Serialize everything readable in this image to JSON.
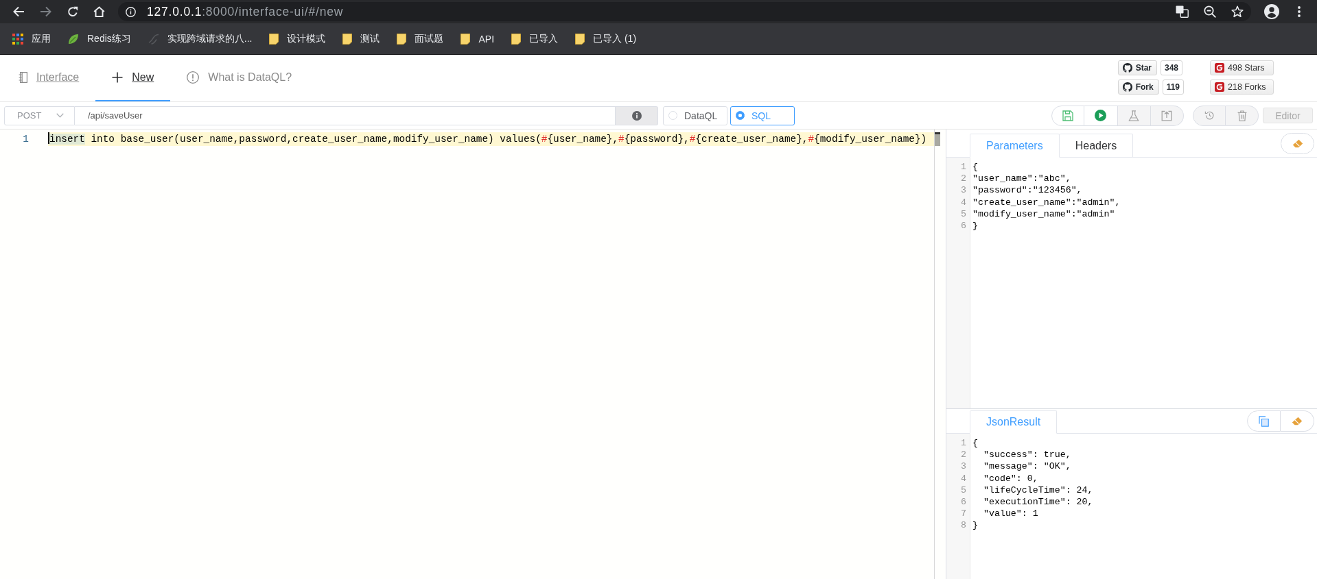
{
  "browser": {
    "url_host": "127.0.0.1",
    "url_rest": ":8000/interface-ui/#/new",
    "bookmarks": [
      {
        "label": "应用",
        "kind": "apps"
      },
      {
        "label": "Redis练习",
        "kind": "leaf"
      },
      {
        "label": "实现跨域请求的八...",
        "kind": "page"
      },
      {
        "label": "设计模式",
        "kind": "folder"
      },
      {
        "label": "测试",
        "kind": "folder"
      },
      {
        "label": "面试题",
        "kind": "folder"
      },
      {
        "label": "API",
        "kind": "folder"
      },
      {
        "label": "已导入",
        "kind": "folder"
      },
      {
        "label": "已导入 (1)",
        "kind": "folder"
      }
    ]
  },
  "nav_tabs": [
    {
      "label": "Interface",
      "kind": "book",
      "selected": false,
      "underlined": true
    },
    {
      "label": "New",
      "kind": "plus",
      "selected": true,
      "underlined": true
    },
    {
      "label": "What is DataQL?",
      "kind": "info",
      "selected": false,
      "underlined": false
    }
  ],
  "github_badges": [
    {
      "label": "Star",
      "count": "348"
    },
    {
      "label": "Fork",
      "count": "119"
    }
  ],
  "gitee_badges": [
    {
      "label": "498 Stars"
    },
    {
      "label": "218 Forks"
    }
  ],
  "request": {
    "method": "POST",
    "path": "/api/saveUser",
    "modes": [
      {
        "label": "DataQL",
        "selected": false
      },
      {
        "label": "SQL",
        "selected": true
      }
    ]
  },
  "actions": [
    {
      "kind": "save",
      "disabled": false
    },
    {
      "kind": "run",
      "disabled": false
    },
    {
      "kind": "test",
      "disabled": true
    },
    {
      "kind": "publish",
      "disabled": true
    }
  ],
  "history_actions": [
    {
      "kind": "history",
      "disabled": true
    },
    {
      "kind": "delete",
      "disabled": true
    }
  ],
  "editor_toggle": {
    "label": "Editor",
    "disabled": true
  },
  "editor": {
    "lines": [
      {
        "number": "1",
        "active": true,
        "cursor": true,
        "tokens": [
          {
            "kind": "match",
            "text": "insert"
          },
          {
            "kind": "text",
            "text": " into base_user(user_name,password,create_user_name,modify_user_name) values("
          },
          {
            "kind": "hash",
            "text": "#"
          },
          {
            "kind": "text",
            "text": "{user_name},"
          },
          {
            "kind": "hash",
            "text": "#"
          },
          {
            "kind": "text",
            "text": "{password},"
          },
          {
            "kind": "hash",
            "text": "#"
          },
          {
            "kind": "text",
            "text": "{create_user_name},"
          },
          {
            "kind": "hash",
            "text": "#"
          },
          {
            "kind": "text",
            "text": "{modify_user_name})"
          }
        ]
      }
    ]
  },
  "parameters_panel": {
    "tabs": [
      {
        "label": "Parameters",
        "selected": true
      },
      {
        "label": "Headers",
        "selected": false
      }
    ],
    "lines": [
      {
        "number": "1",
        "code": "{"
      },
      {
        "number": "2",
        "code": "\"user_name\":\"abc\","
      },
      {
        "number": "3",
        "code": "\"password\":\"123456\","
      },
      {
        "number": "4",
        "code": "\"create_user_name\":\"admin\","
      },
      {
        "number": "5",
        "code": "\"modify_user_name\":\"admin\""
      },
      {
        "number": "6",
        "code": "}"
      }
    ]
  },
  "result_panel": {
    "tabs": [
      {
        "label": "JsonResult",
        "selected": true
      }
    ],
    "lines": [
      {
        "number": "1",
        "code": "{"
      },
      {
        "number": "2",
        "code": "  \"success\": true,"
      },
      {
        "number": "3",
        "code": "  \"message\": \"OK\","
      },
      {
        "number": "4",
        "code": "  \"code\": 0,"
      },
      {
        "number": "5",
        "code": "  \"lifeCycleTime\": 24,"
      },
      {
        "number": "6",
        "code": "  \"executionTime\": 20,"
      },
      {
        "number": "7",
        "code": "  \"value\": 1"
      },
      {
        "number": "8",
        "code": "}"
      }
    ]
  }
}
